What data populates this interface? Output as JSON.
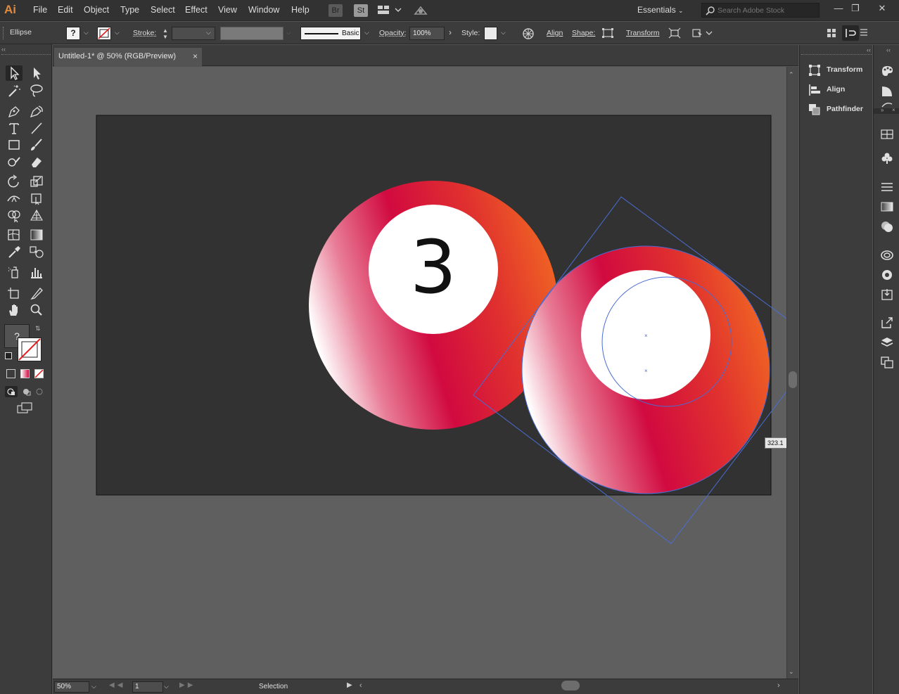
{
  "app": {
    "logo": "Ai"
  },
  "menu": [
    "File",
    "Edit",
    "Object",
    "Type",
    "Select",
    "Effect",
    "View",
    "Window",
    "Help"
  ],
  "menubar_buttons": {
    "bridge": "Br",
    "stock": "St"
  },
  "workspace": {
    "label": "Essentials"
  },
  "search": {
    "placeholder": "Search Adobe Stock"
  },
  "control_bar": {
    "selection_name": "Ellipse",
    "stroke_label": "Stroke:",
    "brush_style": "Basic",
    "opacity_label": "Opacity:",
    "opacity_value": "100%",
    "style_label": "Style:",
    "align_link": "Align",
    "shape_link": "Shape:",
    "transform_link": "Transform",
    "fill_unknown": "?"
  },
  "document": {
    "tab_title": "Untitled-1* @ 50% (RGB/Preview)",
    "close": "×",
    "ball_number": "3",
    "measure_tooltip": "323.1"
  },
  "colors": {
    "ball_gradient": [
      "#ffffff",
      "#d10a40",
      "#f06a22"
    ],
    "artboard": "#323232",
    "selection": "#4a6cd4"
  },
  "status_bar": {
    "zoom": "50%",
    "artboard_number": "1",
    "tool_name": "Selection"
  },
  "panels": [
    {
      "label": "Transform",
      "icon": "transform-icon"
    },
    {
      "label": "Align",
      "icon": "align-icon"
    },
    {
      "label": "Pathfinder",
      "icon": "pathfinder-icon"
    }
  ],
  "toolbar": {
    "fill_unknown": "?"
  }
}
